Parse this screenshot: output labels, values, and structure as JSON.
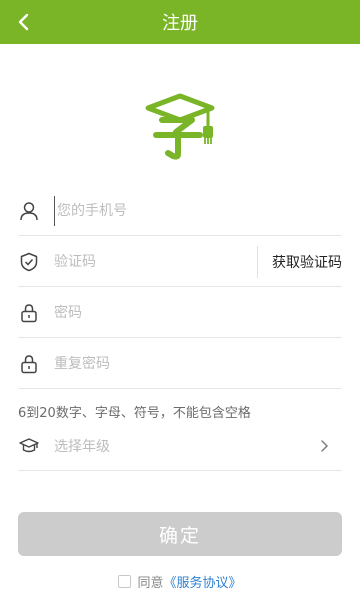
{
  "header": {
    "title": "注册",
    "back_icon": "chevron-left-icon"
  },
  "logo": {
    "glyph": "字",
    "color": "#7ab528"
  },
  "form": {
    "phone": {
      "placeholder": "您的手机号",
      "icon": "user-icon"
    },
    "code": {
      "placeholder": "验证码",
      "icon": "shield-check-icon",
      "button_label": "获取验证码"
    },
    "password": {
      "placeholder": "密码",
      "icon": "lock-icon"
    },
    "repeat_password": {
      "placeholder": "重复密码",
      "icon": "lock-icon"
    },
    "password_hint": "6到20数字、字母、符号，不能包含空格",
    "grade": {
      "label": "选择年级",
      "icon": "grad-cap-icon",
      "chevron": "chevron-right-icon"
    }
  },
  "confirm_button": {
    "label": "确定",
    "bg": "#cccccc"
  },
  "agreement": {
    "prefix": "同意",
    "link": "《服务协议》",
    "link_color": "#2f80d0",
    "checked": false
  },
  "colors": {
    "brand": "#7ab528",
    "divider": "#e6e6e6",
    "placeholder": "#bdbdbd"
  }
}
